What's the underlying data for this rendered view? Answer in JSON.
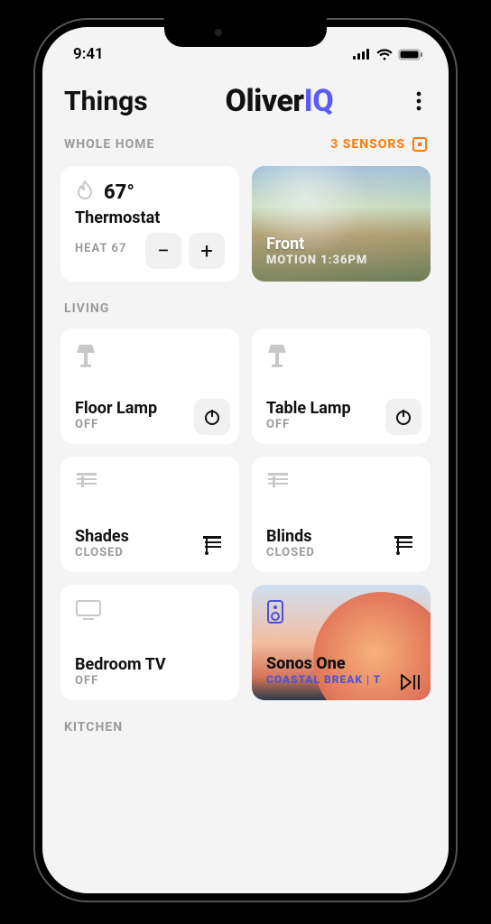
{
  "status": {
    "time": "9:41"
  },
  "header": {
    "title": "Things",
    "logo_oliver": "Oliver",
    "logo_iq": "IQ"
  },
  "whole_home": {
    "label": "WHOLE HOME",
    "sensors": "3 SENSORS",
    "thermostat": {
      "temp": "67°",
      "name": "Thermostat",
      "status": "HEAT 67"
    },
    "front": {
      "name": "Front",
      "status": "MOTION 1:36PM"
    }
  },
  "living": {
    "label": "LIVING",
    "floor_lamp": {
      "name": "Floor Lamp",
      "status": "OFF"
    },
    "table_lamp": {
      "name": "Table Lamp",
      "status": "OFF"
    },
    "shades": {
      "name": "Shades",
      "status": "CLOSED"
    },
    "blinds": {
      "name": "Blinds",
      "status": "CLOSED"
    },
    "bedroom_tv": {
      "name": "Bedroom TV",
      "status": "OFF"
    },
    "sonos": {
      "name": "Sonos One",
      "track": "COASTAL BREAK   |   T"
    }
  },
  "kitchen": {
    "label": "KITCHEN"
  }
}
